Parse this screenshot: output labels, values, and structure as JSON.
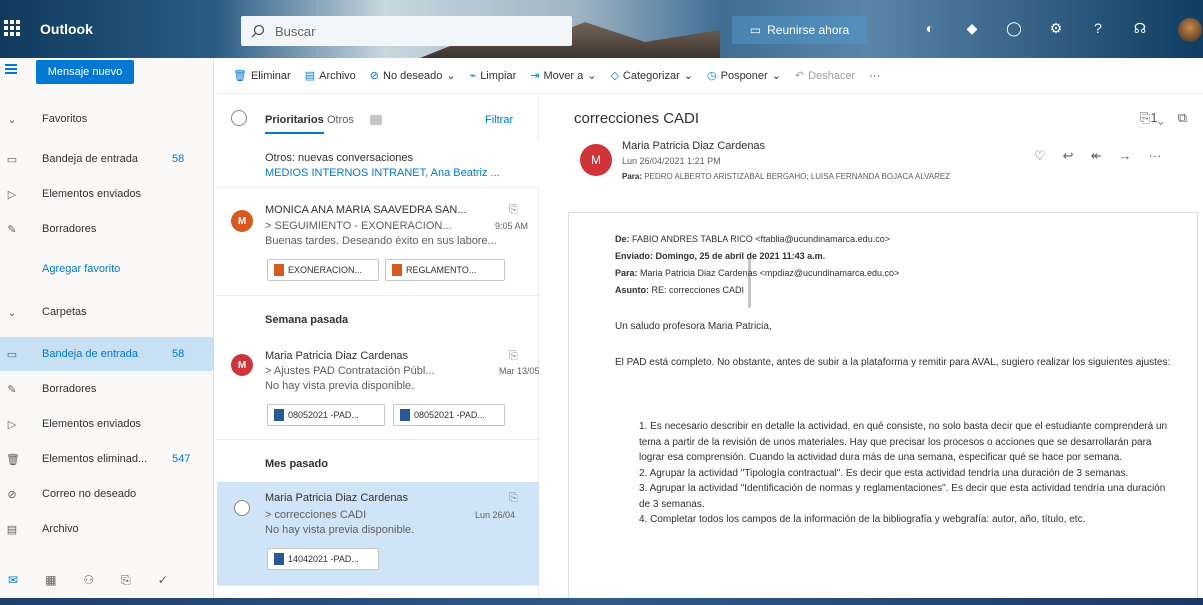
{
  "app": {
    "name": "Outlook"
  },
  "search": {
    "placeholder": "Buscar"
  },
  "meet": {
    "label": "Reunirse ahora"
  },
  "nav": {
    "new_message": "Mensaje nuevo",
    "favorites_header": "Favoritos",
    "favorites": [
      {
        "label": "Bandeja de entrada",
        "count": "58"
      },
      {
        "label": "Elementos enviados",
        "count": ""
      },
      {
        "label": "Borradores",
        "count": ""
      }
    ],
    "add_favorite": "Agregar favorito",
    "folders_header": "Carpetas",
    "folders": [
      {
        "label": "Bandeja de entrada",
        "count": "58"
      },
      {
        "label": "Borradores",
        "count": ""
      },
      {
        "label": "Elementos enviados",
        "count": ""
      },
      {
        "label": "Elementos eliminad...",
        "count": "547"
      },
      {
        "label": "Correo no deseado",
        "count": ""
      },
      {
        "label": "Archivo",
        "count": ""
      }
    ]
  },
  "toolbar": {
    "delete": "Eliminar",
    "archive": "Archivo",
    "junk": "No deseado",
    "sweep": "Limpiar",
    "move": "Mover a",
    "categorize": "Categorizar",
    "snooze": "Posponer",
    "undo": "Deshacer"
  },
  "list": {
    "tab_focused": "Prioritarios",
    "tab_other": "Otros",
    "filter": "Filtrar",
    "other_header": "Otros: nuevas conversaciones",
    "other_senders": "MEDIOS INTERNOS INTRANET, Ana Beatriz ...",
    "group_last_week": "Semana pasada",
    "group_last_month": "Mes pasado",
    "messages": [
      {
        "from": "MONICA ANA MARIA SAAVEDRA SAN...",
        "subject": "> SEGUIMIENTO - EXONERACION...",
        "time": "9:05 AM",
        "preview": "Buenas tardes. Deseando éxito en sus labore...",
        "attachments": [
          "EXONERACION...",
          "REGLAMENTO..."
        ],
        "avatar_initial": "M"
      },
      {
        "from": "Maria Patricia Diaz Cardenas",
        "subject": "> Ajustes PAD Contratación Públ...",
        "time": "Mar 13/05",
        "preview": "No hay vista previa disponible.",
        "attachments": [
          "08052021 -PAD...",
          "08052021 -PAD..."
        ],
        "avatar_initial": "M"
      },
      {
        "from": "Maria Patricia Diaz Cardenas",
        "subject": "> correcciones CADI",
        "time": "Lun 26/04",
        "preview": "No hay vista previa disponible.",
        "attachments": [
          "14042021 -PAD..."
        ]
      }
    ]
  },
  "reading": {
    "subject": "correcciones CADI",
    "count": "1",
    "sender": "Maria Patricia Diaz Cardenas",
    "sender_initial": "M",
    "date": "Lun 26/04/2021 1:21 PM",
    "to_label": "Para:",
    "to": "PEDRO ALBERTO ARISTIZABAL BERGAHO; LUISA FERNANDA BOJACA ALVAREZ",
    "fwd": {
      "from_label": "De:",
      "from": "FABIO ANDRES TABLA RICO <ftablia@ucundinamarca.edu.co>",
      "sent_label": "Enviado:",
      "sent": "Domingo, 25 de abril de 2021 11:43 a.m.",
      "to_label": "Para:",
      "to": "Maria Patricia Diaz Cardenas <mpdiaz@ucundinamarca.edu.co>",
      "subject_label": "Asunto:",
      "subject": "RE: correcciones CADI"
    },
    "greeting": "Un saludo profesora Maria Patricia,",
    "intro": "El PAD está completo. No obstante, antes de subir a la plataforma y remitir para AVAL, sugiero realizar los siguientes ajustes:",
    "items": [
      "1. Es necesario describir en detalle la actividad, en qué consiste, no solo basta decir que el estudiante comprenderá un tema a partir de la revisión de unos materiales. Hay que precisar los procesos o acciones que se desarrollarán para lograr esa comprensión. Cuando la actividad dura más de una semana, especificar qué se hace por semana.",
      "2. Agrupar la actividad \"Tipología contractual\". Es decir que esta actividad tendría una duración de 3 semanas.",
      "3. Agrupar la actividad \"Identificación de normas y reglamentaciones\". Es decir que esta actividad tendría una duración de 3 semanas.",
      "4. Completar todos los campos de la información de la bibliografía y webgrafía: autor, año, título, etc."
    ]
  },
  "colors": {
    "accent": "#0078d4",
    "selected": "#c7e0f4",
    "avatar_orange": "#d9581e",
    "avatar_red": "#d13438"
  }
}
